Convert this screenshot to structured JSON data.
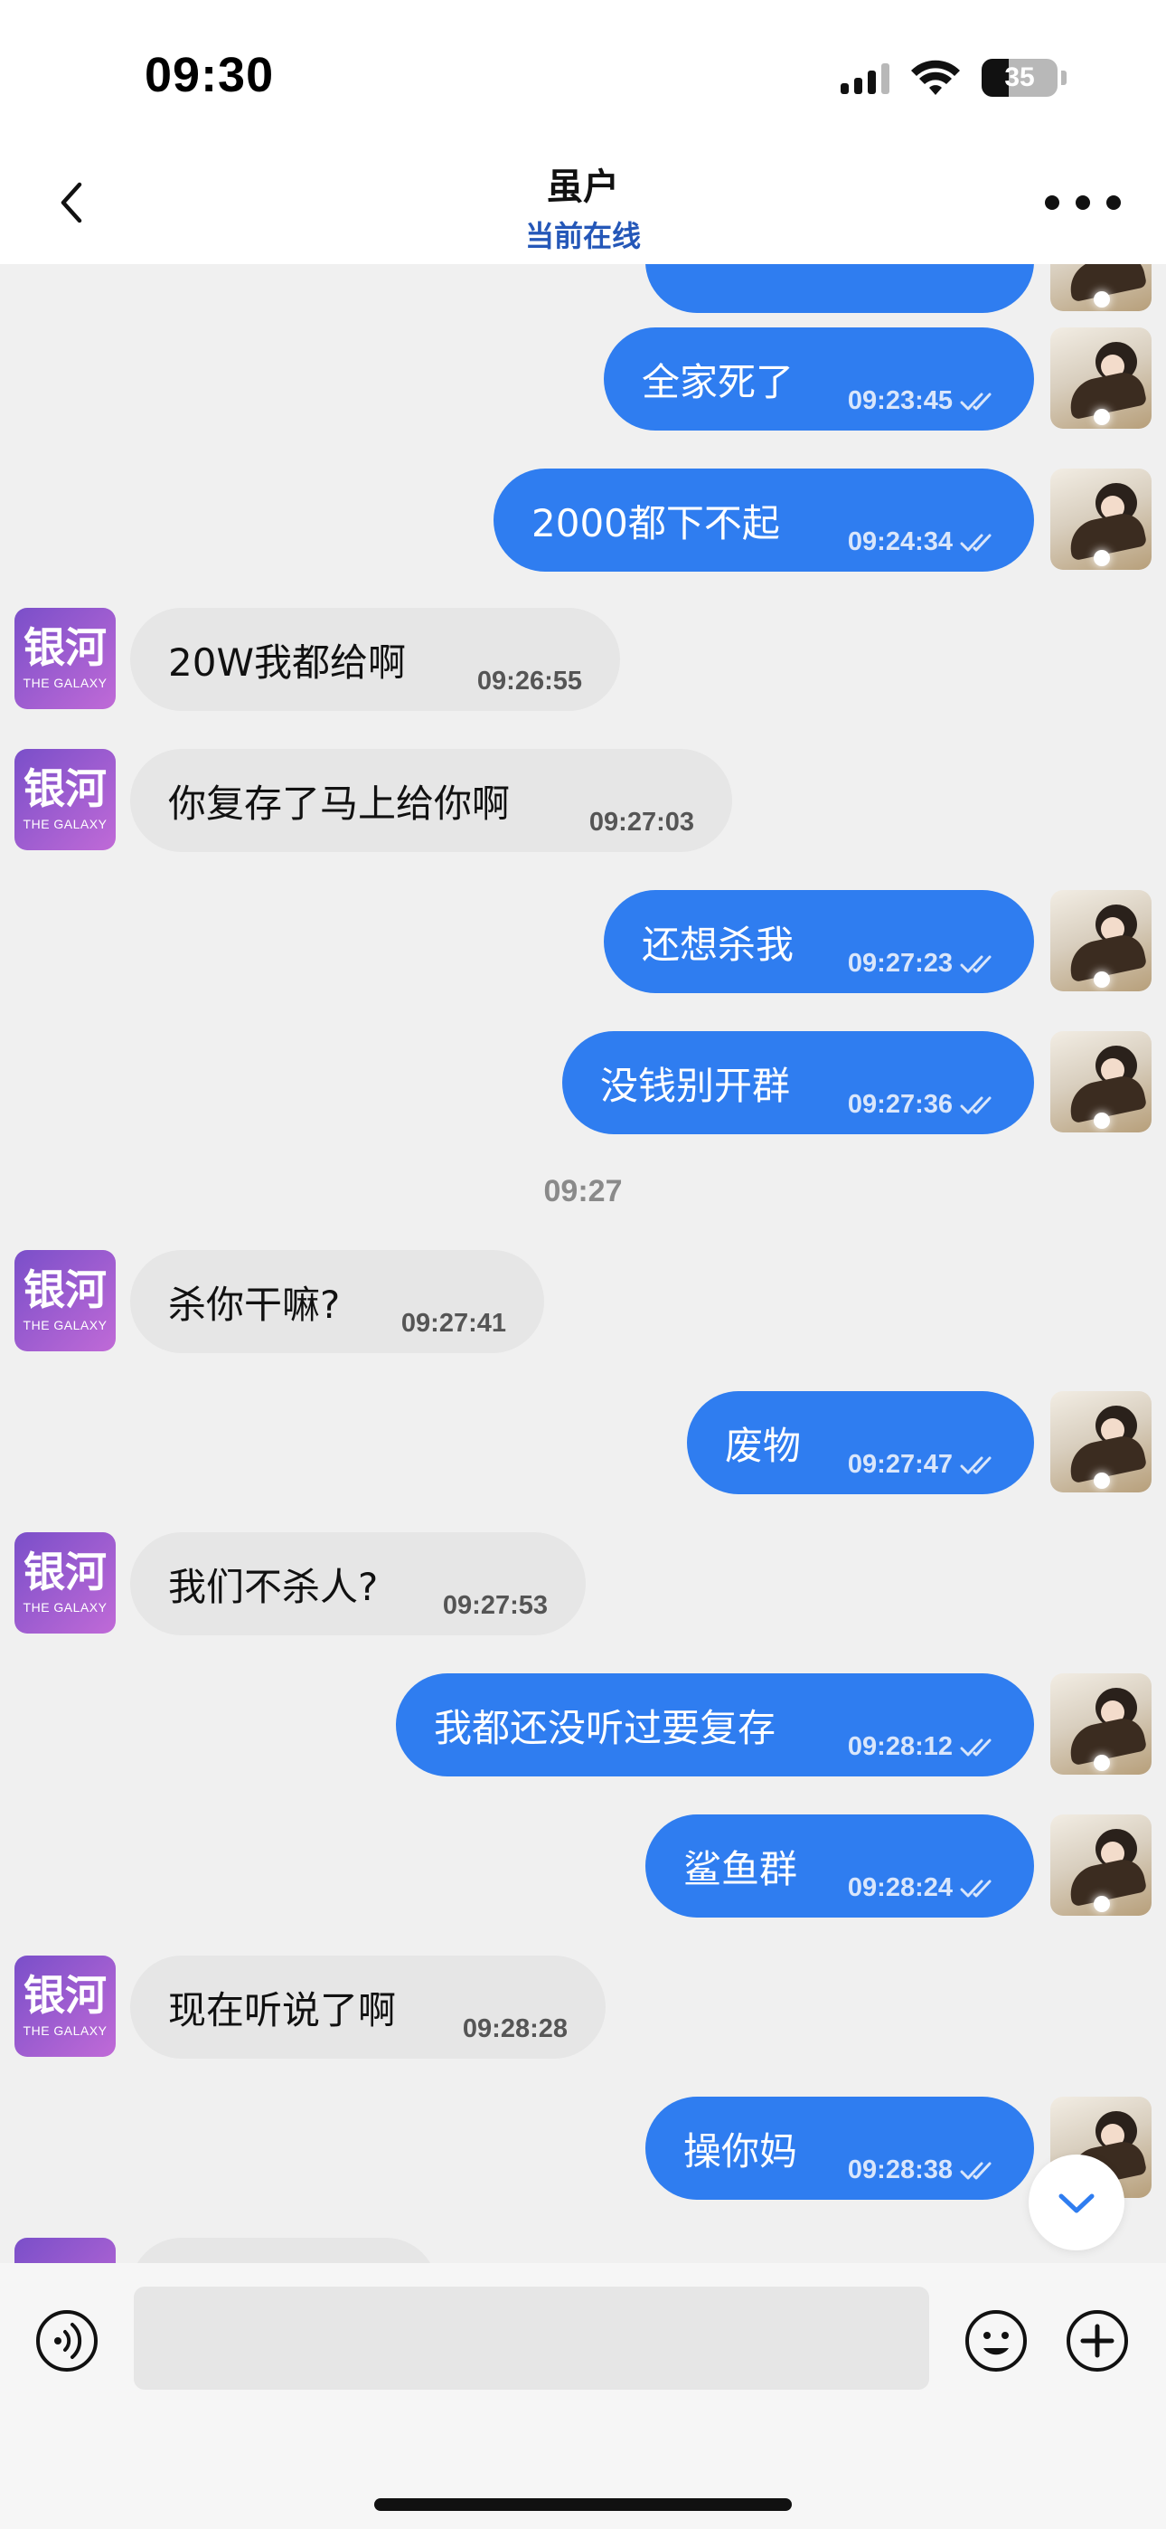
{
  "status_bar": {
    "time": "09:30",
    "battery": "35"
  },
  "header": {
    "title": "虽户",
    "subtitle": "当前在线"
  },
  "group_avatar": {
    "logo_cn": "银河",
    "logo_en": "THE GALAXY"
  },
  "timestamp_divider": "09:27",
  "messages": [
    {
      "direction": "outgoing",
      "text": "全家死了",
      "time": "09:23:45"
    },
    {
      "direction": "outgoing",
      "text": "2000都下不起",
      "time": "09:24:34"
    },
    {
      "direction": "incoming",
      "text": "20W我都给啊",
      "time": "09:26:55"
    },
    {
      "direction": "incoming",
      "text": "你复存了马上给你啊",
      "time": "09:27:03"
    },
    {
      "direction": "outgoing",
      "text": "还想杀我",
      "time": "09:27:23"
    },
    {
      "direction": "outgoing",
      "text": "没钱别开群",
      "time": "09:27:36"
    },
    {
      "direction": "incoming",
      "text": "杀你干嘛?",
      "time": "09:27:41"
    },
    {
      "direction": "outgoing",
      "text": "废物",
      "time": "09:27:47"
    },
    {
      "direction": "incoming",
      "text": "我们不杀人?",
      "time": "09:27:53"
    },
    {
      "direction": "outgoing",
      "text": "我都还没听过要复存",
      "time": "09:28:12"
    },
    {
      "direction": "outgoing",
      "text": "鲨鱼群",
      "time": "09:28:24"
    },
    {
      "direction": "incoming",
      "text": "现在听说了啊",
      "time": "09:28:28"
    },
    {
      "direction": "outgoing",
      "text": "操你妈",
      "time": "09:28:38"
    }
  ],
  "composer": {
    "input_value": "",
    "placeholder": ""
  },
  "colors": {
    "outgoing_bubble": "#2f7df0",
    "incoming_bubble": "#e6e6e6",
    "online_status": "#2457b8",
    "background": "#f0f0f0"
  },
  "icons": {
    "back": "chevron-left-icon",
    "more": "more-dots-icon",
    "read": "double-check-icon",
    "scroll": "chevron-down-icon",
    "voice": "voice-icon",
    "emoji": "emoji-icon",
    "plus": "plus-icon"
  }
}
